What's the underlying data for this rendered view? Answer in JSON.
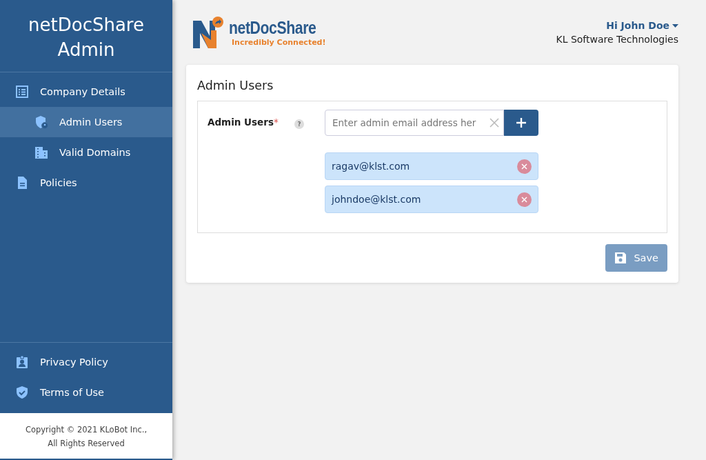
{
  "sidebar": {
    "title": "netDocShare Admin",
    "items": [
      {
        "label": "Company Details",
        "selected": false,
        "children": [
          {
            "label": "Admin Users",
            "selected": true
          },
          {
            "label": "Valid Domains",
            "selected": false
          }
        ]
      },
      {
        "label": "Policies",
        "selected": false
      }
    ],
    "footer_links": [
      "Privacy Policy",
      "Terms of Use"
    ],
    "copyright": [
      "Copyright © 2021 KLoBot Inc.,",
      "All Rights Reserved"
    ]
  },
  "header": {
    "logo_name": "netDocShare",
    "logo_tagline": "Incredibly Connected!",
    "user": "Hi John Doe",
    "company": "KL Software Technologies"
  },
  "card": {
    "title": "Admin Users",
    "field_label": "Admin Users",
    "required_mark": "*",
    "help": "?",
    "placeholder": "Enter admin email address her",
    "entries": [
      "ragav@klst.com",
      "johndoe@klst.com"
    ],
    "save": "Save"
  }
}
